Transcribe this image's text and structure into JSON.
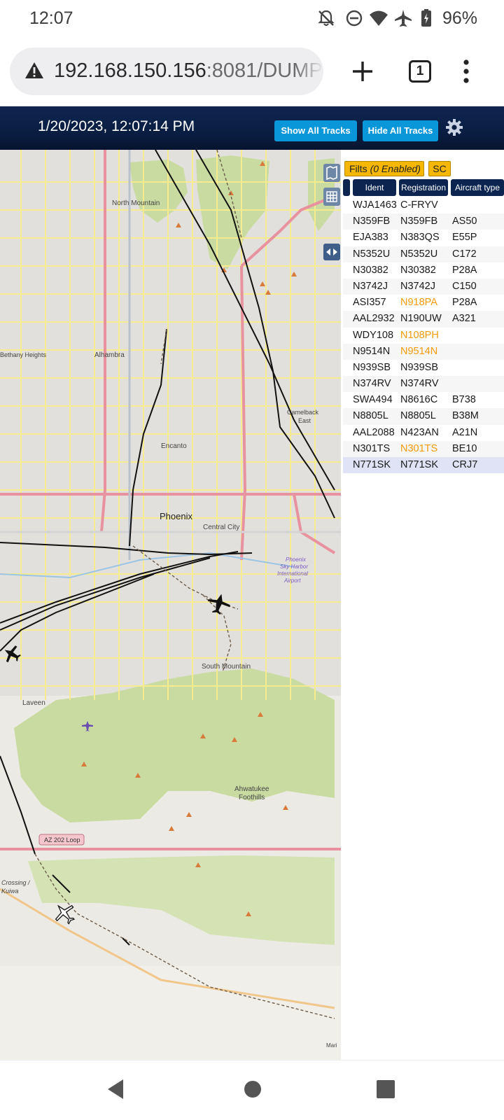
{
  "status_bar": {
    "time": "12:07",
    "battery": "96%"
  },
  "browser": {
    "url_host": "192.168.150.156",
    "url_rest": ":8081/DUMP",
    "tab_count": "1"
  },
  "app": {
    "datetime": "1/20/2023, 12:07:14 PM",
    "show_all_label": "Show All Tracks",
    "hide_all_label": "Hide All Tracks"
  },
  "filters": {
    "label": "Filts",
    "enabled_text": "(0 Enabled)",
    "sc_label": "SC"
  },
  "table": {
    "columns": [
      "Ident",
      "Registration",
      "Aircraft type"
    ],
    "rows": [
      {
        "ident": "WJA1463",
        "reg": "C-FRYV",
        "type": "",
        "reg_orange": false
      },
      {
        "ident": "N359FB",
        "reg": "N359FB",
        "type": "AS50",
        "reg_orange": false
      },
      {
        "ident": "EJA383",
        "reg": "N383QS",
        "type": "E55P",
        "reg_orange": false
      },
      {
        "ident": "N5352U",
        "reg": "N5352U",
        "type": "C172",
        "reg_orange": false
      },
      {
        "ident": "N30382",
        "reg": "N30382",
        "type": "P28A",
        "reg_orange": false
      },
      {
        "ident": "N3742J",
        "reg": "N3742J",
        "type": "C150",
        "reg_orange": false
      },
      {
        "ident": "ASI357",
        "reg": "N918PA",
        "type": "P28A",
        "reg_orange": true
      },
      {
        "ident": "AAL2932",
        "reg": "N190UW",
        "type": "A321",
        "reg_orange": false
      },
      {
        "ident": "WDY108",
        "reg": "N108PH",
        "type": "",
        "reg_orange": true
      },
      {
        "ident": "N9514N",
        "reg": "N9514N",
        "type": "",
        "reg_orange": true
      },
      {
        "ident": "N939SB",
        "reg": "N939SB",
        "type": "",
        "reg_orange": false
      },
      {
        "ident": "N374RV",
        "reg": "N374RV",
        "type": "",
        "reg_orange": false
      },
      {
        "ident": "SWA494",
        "reg": "N8616C",
        "type": "B738",
        "reg_orange": false
      },
      {
        "ident": "N8805L",
        "reg": "N8805L",
        "type": "B38M",
        "reg_orange": false
      },
      {
        "ident": "AAL2088",
        "reg": "N423AN",
        "type": "A21N",
        "reg_orange": false
      },
      {
        "ident": "N301TS",
        "reg": "N301TS",
        "type": "BE10",
        "reg_orange": true
      },
      {
        "ident": "N771SK",
        "reg": "N771SK",
        "type": "CRJ7",
        "reg_orange": false,
        "selected": true
      }
    ]
  },
  "map": {
    "labels": {
      "north_mountain": "North Mountain",
      "bethany_heights": "Bethany Heights",
      "alhambra": "Alhambra",
      "encanto": "Encanto",
      "phoenix": "Phoenix",
      "central_city": "Central City",
      "camelback_east_1": "Camelback",
      "camelback_east_2": "East",
      "sky_harbor_1": "Phoenix",
      "sky_harbor_2": "Sky Harbor",
      "sky_harbor_3": "International",
      "sky_harbor_4": "Airport",
      "south_mountain": "South Mountain",
      "laveen": "Laveen",
      "ahwatukee_1": "Ahwatukee",
      "ahwatukee_2": "Foothills",
      "az202": "AZ 202 Loop",
      "crossing": "Crossing /",
      "kuiwa": "Kuiwa",
      "mari": "Mari"
    },
    "colors": {
      "land": "#eceae4",
      "park": "#c9dba1",
      "major_road": "#e8929f",
      "minor_road": "#f6f0a0",
      "track": "#111111"
    }
  }
}
